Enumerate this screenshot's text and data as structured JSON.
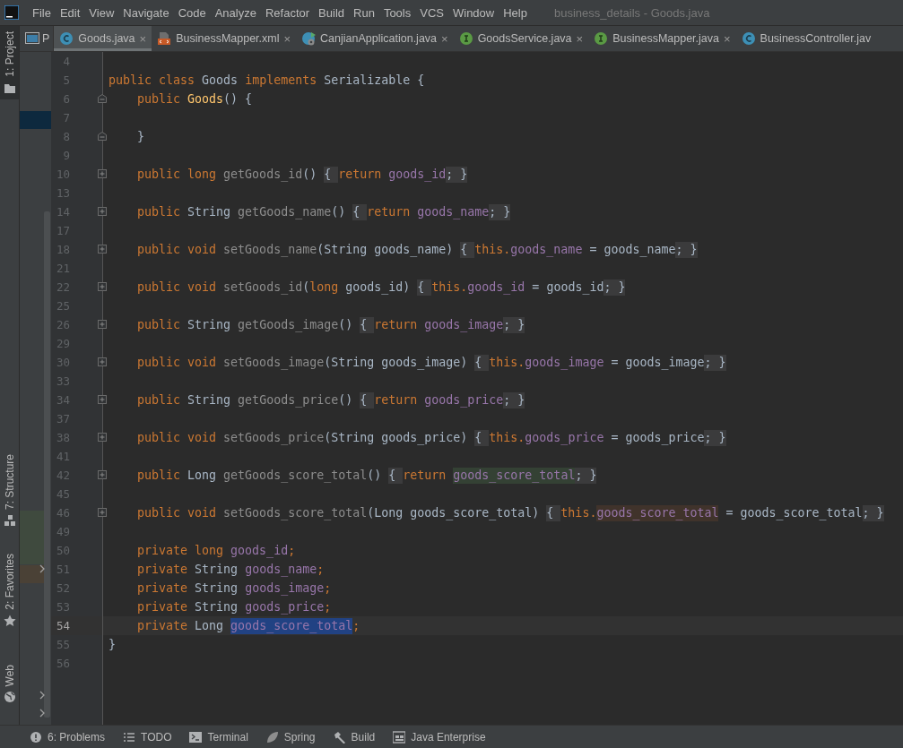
{
  "menu": [
    "File",
    "Edit",
    "View",
    "Navigate",
    "Code",
    "Analyze",
    "Refactor",
    "Build",
    "Run",
    "Tools",
    "VCS",
    "Window",
    "Help"
  ],
  "window": {
    "title": "business_details - Goods.java"
  },
  "project_panel_tab": {
    "label": "P"
  },
  "tabs": [
    {
      "label": "Goods.java",
      "kind": "class",
      "selected": true,
      "close": "×"
    },
    {
      "label": "BusinessMapper.xml",
      "kind": "xml",
      "selected": false,
      "close": "×"
    },
    {
      "label": "CanjianApplication.java",
      "kind": "app",
      "selected": false,
      "close": "×"
    },
    {
      "label": "GoodsService.java",
      "kind": "interface",
      "selected": false,
      "close": "×"
    },
    {
      "label": "BusinessMapper.java",
      "kind": "interface",
      "selected": false,
      "close": "×"
    },
    {
      "label": "BusinessController.jav",
      "kind": "class",
      "selected": false
    }
  ],
  "tool_strip": [
    {
      "label": "1: Project",
      "kind": "folder",
      "selected": true
    },
    {
      "label": "7: Structure",
      "kind": "structure",
      "selected": false
    },
    {
      "label": "2: Favorites",
      "kind": "star",
      "selected": false
    },
    {
      "label": "Web",
      "kind": "globe",
      "selected": false
    }
  ],
  "code_lines": [
    {
      "number": "4",
      "current": false
    },
    {
      "number": "5",
      "current": false,
      "tokens": [
        {
          "kind": "keyword",
          "text": "public class "
        },
        {
          "kind": "plain",
          "text": "Goods "
        },
        {
          "kind": "keyword",
          "text": "implements "
        },
        {
          "kind": "plain",
          "text": "Serializable {"
        }
      ]
    },
    {
      "number": "6",
      "current": false,
      "folded": false,
      "tokens": [
        {
          "kind": "keyword",
          "text": "    public "
        },
        {
          "kind": "name",
          "text": "Goods"
        },
        {
          "kind": "plain",
          "text": "() {"
        }
      ]
    },
    {
      "number": "7",
      "current": false
    },
    {
      "number": "8",
      "current": false,
      "folded": false,
      "tokens": [
        {
          "kind": "plain",
          "text": "    }"
        }
      ]
    },
    {
      "number": "9",
      "current": false
    },
    {
      "number": "10",
      "current": false,
      "folded": true,
      "tokens": [
        {
          "kind": "keyword",
          "text": "    public long "
        },
        {
          "kind": "unused",
          "text": "getGoods_id"
        },
        {
          "kind": "plain",
          "text": "() "
        },
        {
          "kind": "folded",
          "text": "{ "
        },
        {
          "kind": "keyword",
          "text": "return "
        },
        {
          "kind": "field",
          "text": "goods_id"
        },
        {
          "kind": "folded",
          "text": "; }"
        }
      ]
    },
    {
      "number": "13",
      "current": false
    },
    {
      "number": "14",
      "current": false,
      "folded": true,
      "tokens": [
        {
          "kind": "keyword",
          "text": "    public "
        },
        {
          "kind": "plain",
          "text": "String "
        },
        {
          "kind": "unused",
          "text": "getGoods_name"
        },
        {
          "kind": "plain",
          "text": "() "
        },
        {
          "kind": "folded",
          "text": "{ "
        },
        {
          "kind": "keyword",
          "text": "return "
        },
        {
          "kind": "field",
          "text": "goods_name"
        },
        {
          "kind": "folded",
          "text": "; }"
        }
      ]
    },
    {
      "number": "17",
      "current": false
    },
    {
      "number": "18",
      "current": false,
      "folded": true,
      "tokens": [
        {
          "kind": "keyword",
          "text": "    public void "
        },
        {
          "kind": "unused",
          "text": "setGoods_name"
        },
        {
          "kind": "plain",
          "text": "(String goods_name) "
        },
        {
          "kind": "folded",
          "text": "{ "
        },
        {
          "kind": "keyword",
          "text": "this."
        },
        {
          "kind": "field",
          "text": "goods_name"
        },
        {
          "kind": "plain",
          "text": " = goods_name"
        },
        {
          "kind": "folded",
          "text": "; }"
        }
      ]
    },
    {
      "number": "21",
      "current": false
    },
    {
      "number": "22",
      "current": false,
      "folded": true,
      "tokens": [
        {
          "kind": "keyword",
          "text": "    public void "
        },
        {
          "kind": "unused",
          "text": "setGoods_id"
        },
        {
          "kind": "plain",
          "text": "("
        },
        {
          "kind": "keyword",
          "text": "long "
        },
        {
          "kind": "plain",
          "text": "goods_id) "
        },
        {
          "kind": "folded",
          "text": "{ "
        },
        {
          "kind": "keyword",
          "text": "this."
        },
        {
          "kind": "field",
          "text": "goods_id"
        },
        {
          "kind": "plain",
          "text": " = goods_id"
        },
        {
          "kind": "folded",
          "text": "; }"
        }
      ]
    },
    {
      "number": "25",
      "current": false
    },
    {
      "number": "26",
      "current": false,
      "folded": true,
      "tokens": [
        {
          "kind": "keyword",
          "text": "    public "
        },
        {
          "kind": "plain",
          "text": "String "
        },
        {
          "kind": "unused",
          "text": "getGoods_image"
        },
        {
          "kind": "plain",
          "text": "() "
        },
        {
          "kind": "folded",
          "text": "{ "
        },
        {
          "kind": "keyword",
          "text": "return "
        },
        {
          "kind": "field",
          "text": "goods_image"
        },
        {
          "kind": "folded",
          "text": "; }"
        }
      ]
    },
    {
      "number": "29",
      "current": false
    },
    {
      "number": "30",
      "current": false,
      "folded": true,
      "tokens": [
        {
          "kind": "keyword",
          "text": "    public void "
        },
        {
          "kind": "unused",
          "text": "setGoods_image"
        },
        {
          "kind": "plain",
          "text": "(String goods_image) "
        },
        {
          "kind": "folded",
          "text": "{ "
        },
        {
          "kind": "keyword",
          "text": "this."
        },
        {
          "kind": "field",
          "text": "goods_image"
        },
        {
          "kind": "plain",
          "text": " = goods_image"
        },
        {
          "kind": "folded",
          "text": "; }"
        }
      ]
    },
    {
      "number": "33",
      "current": false
    },
    {
      "number": "34",
      "current": false,
      "folded": true,
      "tokens": [
        {
          "kind": "keyword",
          "text": "    public "
        },
        {
          "kind": "plain",
          "text": "String "
        },
        {
          "kind": "unused",
          "text": "getGoods_price"
        },
        {
          "kind": "plain",
          "text": "() "
        },
        {
          "kind": "folded",
          "text": "{ "
        },
        {
          "kind": "keyword",
          "text": "return "
        },
        {
          "kind": "field",
          "text": "goods_price"
        },
        {
          "kind": "folded",
          "text": "; }"
        }
      ]
    },
    {
      "number": "37",
      "current": false
    },
    {
      "number": "38",
      "current": false,
      "folded": true,
      "tokens": [
        {
          "kind": "keyword",
          "text": "    public void "
        },
        {
          "kind": "unused",
          "text": "setGoods_price"
        },
        {
          "kind": "plain",
          "text": "(String goods_price) "
        },
        {
          "kind": "folded",
          "text": "{ "
        },
        {
          "kind": "keyword",
          "text": "this."
        },
        {
          "kind": "field",
          "text": "goods_price"
        },
        {
          "kind": "plain",
          "text": " = goods_price"
        },
        {
          "kind": "folded",
          "text": "; }"
        }
      ]
    },
    {
      "number": "41",
      "current": false
    },
    {
      "number": "42",
      "current": false,
      "folded": true,
      "tokens": [
        {
          "kind": "keyword",
          "text": "    public "
        },
        {
          "kind": "plain",
          "text": "Long "
        },
        {
          "kind": "unused",
          "text": "getGoods_score_total"
        },
        {
          "kind": "plain",
          "text": "() "
        },
        {
          "kind": "folded",
          "text": "{ "
        },
        {
          "kind": "keyword",
          "text": "return "
        },
        {
          "kind": "read",
          "text": "goods_score_total"
        },
        {
          "kind": "folded",
          "text": "; }"
        }
      ]
    },
    {
      "number": "45",
      "current": false
    },
    {
      "number": "46",
      "current": false,
      "folded": true,
      "tokens": [
        {
          "kind": "keyword",
          "text": "    public void "
        },
        {
          "kind": "unused",
          "text": "setGoods_score_total"
        },
        {
          "kind": "plain",
          "text": "(Long goods_score_total) "
        },
        {
          "kind": "folded",
          "text": "{ "
        },
        {
          "kind": "keyword",
          "text": "this."
        },
        {
          "kind": "write",
          "text": "goods_score_total"
        },
        {
          "kind": "plain",
          "text": " = goods_score_total"
        },
        {
          "kind": "folded",
          "text": "; }"
        }
      ]
    },
    {
      "number": "49",
      "current": false
    },
    {
      "number": "50",
      "current": false,
      "tokens": [
        {
          "kind": "keyword",
          "text": "    private long "
        },
        {
          "kind": "field",
          "text": "goods_id"
        },
        {
          "kind": "keyword",
          "text": ";"
        }
      ]
    },
    {
      "number": "51",
      "current": false,
      "tokens": [
        {
          "kind": "keyword",
          "text": "    private "
        },
        {
          "kind": "plain",
          "text": "String "
        },
        {
          "kind": "field",
          "text": "goods_name"
        },
        {
          "kind": "keyword",
          "text": ";"
        }
      ]
    },
    {
      "number": "52",
      "current": false,
      "tokens": [
        {
          "kind": "keyword",
          "text": "    private "
        },
        {
          "kind": "plain",
          "text": "String "
        },
        {
          "kind": "field",
          "text": "goods_image"
        },
        {
          "kind": "keyword",
          "text": ";"
        }
      ]
    },
    {
      "number": "53",
      "current": false,
      "tokens": [
        {
          "kind": "keyword",
          "text": "    private "
        },
        {
          "kind": "plain",
          "text": "String "
        },
        {
          "kind": "field",
          "text": "goods_price"
        },
        {
          "kind": "keyword",
          "text": ";"
        }
      ]
    },
    {
      "number": "54",
      "current": true,
      "tokens": [
        {
          "kind": "keyword",
          "text": "    private "
        },
        {
          "kind": "plain",
          "text": "Long "
        },
        {
          "kind": "selected",
          "text": "goods_score_total"
        },
        {
          "kind": "keyword",
          "text": ";"
        }
      ]
    },
    {
      "number": "55",
      "current": false,
      "tokens": [
        {
          "kind": "plain",
          "text": "}"
        }
      ]
    },
    {
      "number": "56",
      "current": false
    }
  ],
  "bottom_tools": [
    {
      "label": "6: Problems",
      "kind": "problems"
    },
    {
      "label": "TODO",
      "kind": "list"
    },
    {
      "label": "Terminal",
      "kind": "terminal"
    },
    {
      "label": "Spring",
      "kind": "leaf"
    },
    {
      "label": "Build",
      "kind": "hammer"
    },
    {
      "label": "Java Enterprise",
      "kind": "enterprise"
    }
  ]
}
